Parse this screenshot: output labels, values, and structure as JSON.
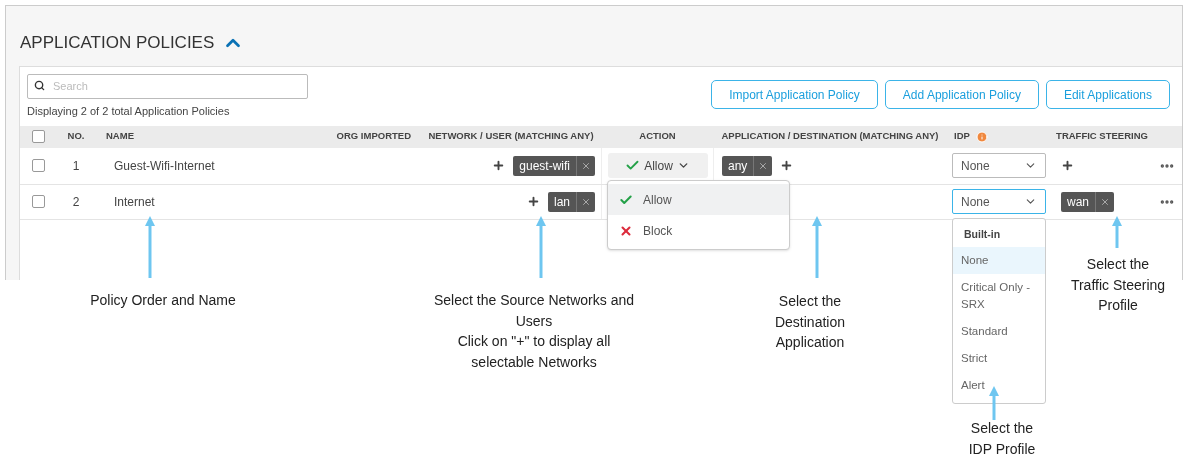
{
  "section": {
    "title": "APPLICATION POLICIES",
    "expanded": true
  },
  "search": {
    "placeholder": "Search"
  },
  "summary": "Displaying 2 of 2 total Application Policies",
  "buttons": [
    "Import Application Policy",
    "Add Application Policy",
    "Edit Applications"
  ],
  "header_checkbox": {
    "checked": false
  },
  "columns": [
    "NO.",
    "NAME",
    "ORG IMPORTED",
    "NETWORK / USER (MATCHING ANY)",
    "ACTION",
    "APPLICATION / DESTINATION (MATCHING ANY)",
    "IDP",
    "TRAFFIC STEERING"
  ],
  "rows": [
    {
      "checked": false,
      "no": "1",
      "name": "Guest-Wifi-Internet",
      "networks": [
        "guest-wifi"
      ],
      "action": "Allow",
      "applications": [
        "any"
      ],
      "idp": "None",
      "idp_focused": false,
      "steering": []
    },
    {
      "checked": false,
      "no": "2",
      "name": "Internet",
      "networks": [
        "lan"
      ],
      "applications": [],
      "idp": "None",
      "idp_focused": true,
      "steering": [
        "wan"
      ]
    }
  ],
  "action_menu": [
    {
      "label": "Allow",
      "kind": "allow",
      "selected": true
    },
    {
      "label": "Block",
      "kind": "block",
      "selected": false
    }
  ],
  "idp_menu": {
    "group": "Built-in",
    "items": [
      {
        "label": "None",
        "selected": true
      },
      {
        "label": "Critical Only - SRX",
        "selected": false
      },
      {
        "label": "Standard",
        "selected": false
      },
      {
        "label": "Strict",
        "selected": false
      },
      {
        "label": "Alert",
        "selected": false
      }
    ]
  },
  "annotations": [
    {
      "lines": [
        "Policy Order and Name"
      ]
    },
    {
      "lines": [
        "Select the Source Networks and",
        "Users",
        "Click on \"+\" to display all",
        "selectable Networks"
      ]
    },
    {
      "lines": [
        "Select the",
        "Destination",
        "Application"
      ]
    },
    {
      "lines": [
        "Select the",
        "IDP Profile"
      ]
    },
    {
      "lines": [
        "Select the",
        "Traffic Steering",
        "Profile"
      ]
    }
  ]
}
